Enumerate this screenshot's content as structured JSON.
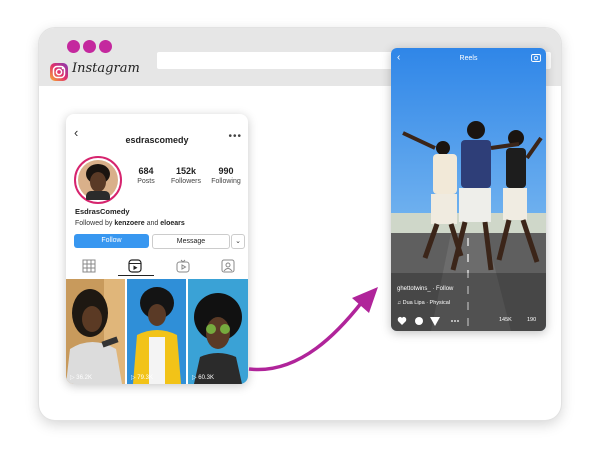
{
  "browser": {
    "brand": "Instagram",
    "window_dot_color": "#c4289e",
    "icons": [
      "instagram-logo-icon"
    ]
  },
  "profile": {
    "username": "esdrascomedy",
    "display_name": "EsdrasComedy",
    "followed_by_prefix": "Followed by",
    "followed_by_user1": "kenzoere",
    "followed_by_and": "and",
    "followed_by_user2": "eloears",
    "posts_count": "684",
    "posts_label": "Posts",
    "followers_count": "152k",
    "followers_label": "Followers",
    "following_count": "990",
    "following_label": "Following",
    "follow_button": "Follow",
    "message_button": "Message",
    "chevron": "⌄",
    "tabs": [
      "grid-icon",
      "reels-icon",
      "igtv-icon",
      "tagged-icon"
    ],
    "thumbnails": [
      {
        "views": "▷ 36.2K"
      },
      {
        "views": "▷ 79.3K"
      },
      {
        "views": "▷ 60.3K"
      }
    ],
    "accent_color": "#3897f0"
  },
  "reels": {
    "title": "Reels",
    "user": "ghettotwins_ · Follow",
    "song": "♫ Dua Lipa · Physical",
    "likes": "145K",
    "comments": "190",
    "icons": [
      "heart-icon",
      "comment-icon",
      "send-icon",
      "more-icon"
    ]
  },
  "arrow_color": "#b0249a"
}
